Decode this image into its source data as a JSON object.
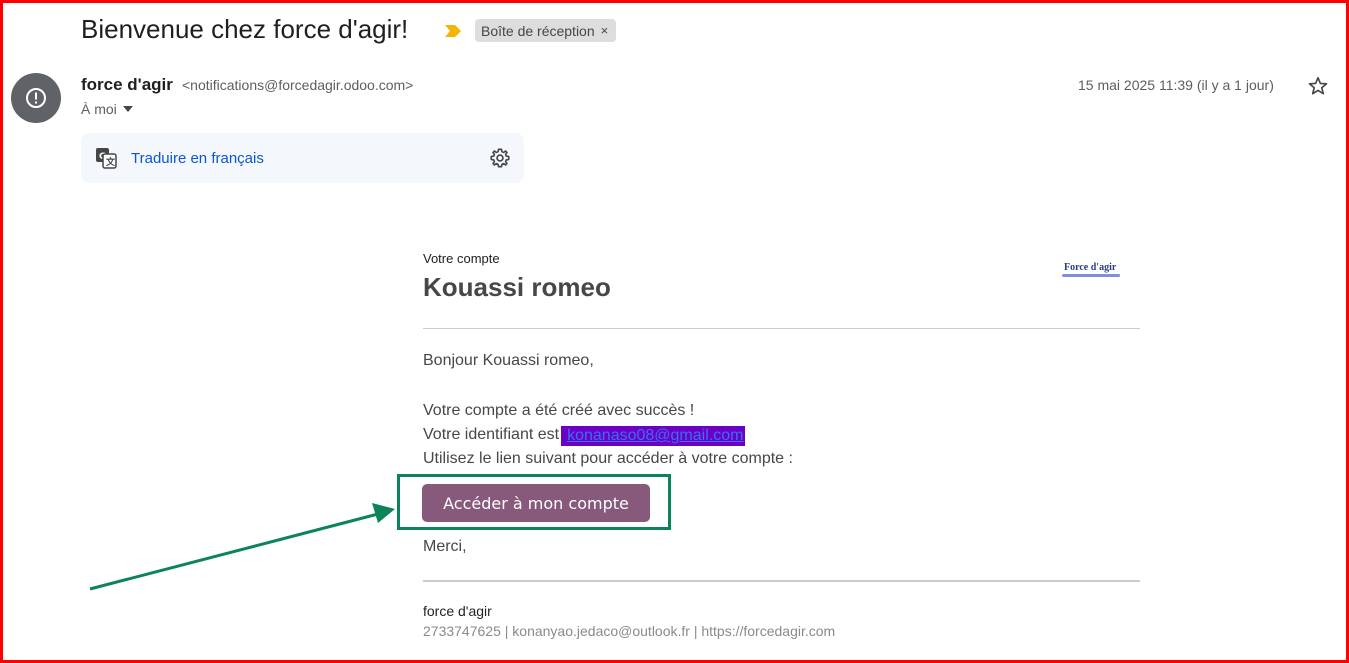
{
  "email": {
    "subject": "Bienvenue chez force d'agir!",
    "label": "Boîte de réception",
    "label_close": "×",
    "sender_name": "force d'agir",
    "sender_email": "<notifications@forcedagir.odoo.com>",
    "recipient": "À moi",
    "date": "15 mai 2025 11:39 (il y a 1 jour)",
    "icons": {
      "avatar": "exclamation-icon",
      "importance": "importance-marker-icon",
      "star": "star-icon",
      "translate": "translate-icon",
      "settings": "gear-icon",
      "dropdown": "caret-down-icon"
    }
  },
  "translate_bar": {
    "link": "Traduire en français"
  },
  "message": {
    "section_label": "Votre compte",
    "user_name": "Kouassi romeo",
    "logo_text": "Force d'agir",
    "greeting": "Bonjour Kouassi romeo,",
    "created_line": "Votre compte a été créé avec succès !",
    "login_prefix": "Votre identifiant est",
    "login_email": "konanaso08@gmail.com",
    "link_line": "Utilisez le lien suivant pour accéder à votre compte :",
    "button_label": "Accéder à mon compte",
    "thanks": "Merci,",
    "footer_company": "force d'agir",
    "footer_contact": "2733747625 | konanyao.jedaco@outlook.fr | https://forcedagir.com"
  },
  "colors": {
    "button": "#875a7b",
    "annotation": "#0b8457",
    "frame": "#ff0000",
    "link": "#0b57d0",
    "redaction": "#6b00c6"
  }
}
